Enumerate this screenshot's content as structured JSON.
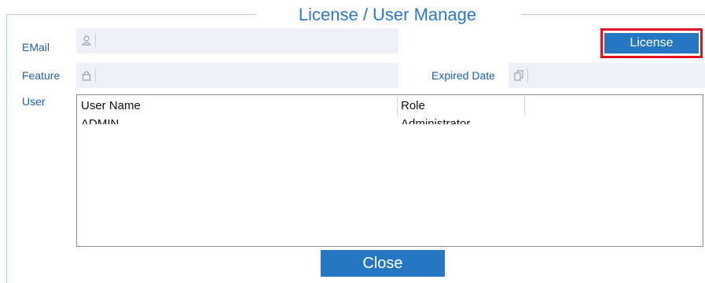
{
  "dialog": {
    "title": "License / User Manage"
  },
  "form": {
    "email_label": "EMail",
    "email_value": "",
    "feature_label": "Feature",
    "feature_value": "",
    "expired_label": "Expired Date",
    "expired_value": "",
    "user_label": "User"
  },
  "icons": {
    "email": "user-icon",
    "feature": "lock-icon",
    "expired": "copy-icon"
  },
  "buttons": {
    "license": "License",
    "close": "Close"
  },
  "users_table": {
    "columns": [
      "User Name",
      "Role"
    ],
    "rows": [
      [
        "ADMIN",
        "Administrator"
      ]
    ]
  },
  "colors": {
    "accent": "#2577c2",
    "title": "#2b78c8",
    "label": "#1f5fa8",
    "highlight": "#e0101e",
    "field_bg": "#eef2f8"
  }
}
